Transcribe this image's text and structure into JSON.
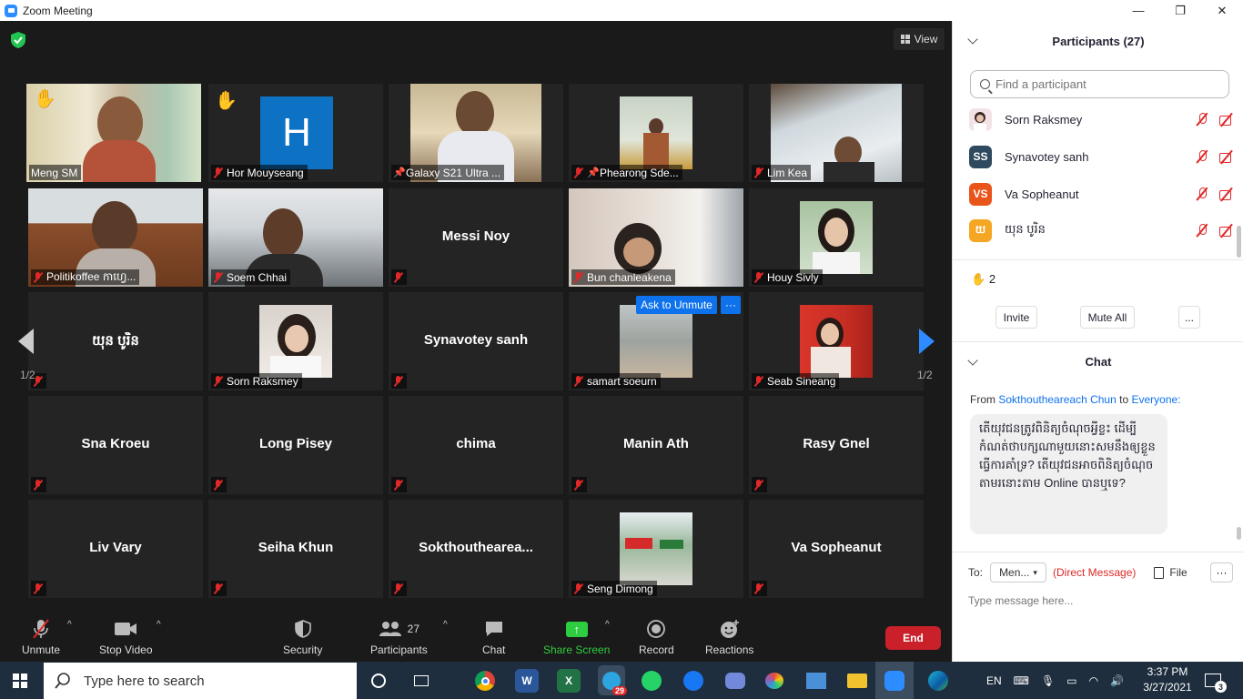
{
  "window": {
    "title": "Zoom Meeting",
    "minimize": "—",
    "restore": "❐",
    "close": "✕"
  },
  "view_button": {
    "label": "View"
  },
  "tiles": [
    {
      "name": "Meng SM",
      "muted": false,
      "hand": true,
      "active": true,
      "video": true
    },
    {
      "name": "Hor Mouyseang",
      "muted": true,
      "hand": true,
      "avatar_letter": "H"
    },
    {
      "name": "Galaxy S21 Ultra ...",
      "pinned": true,
      "video": true
    },
    {
      "name": "Phearong Sde...",
      "muted": true,
      "pinned": true,
      "video": true
    },
    {
      "name": "Lim Kea",
      "muted": true,
      "video": true
    },
    {
      "name": "Politikoffee កាហ្វេ...",
      "muted": true,
      "video": true
    },
    {
      "name": "Soem Chhai",
      "muted": true,
      "video": true
    },
    {
      "name": "Messi Noy",
      "muted": true
    },
    {
      "name": "Bun chanleakena",
      "muted": true,
      "video": true
    },
    {
      "name": "Houy Sivly",
      "muted": true,
      "video": true
    },
    {
      "name": "យុន បូរិន",
      "muted": true
    },
    {
      "name": "Sorn Raksmey",
      "muted": true,
      "video": true
    },
    {
      "name": "Synavotey sanh",
      "muted": true
    },
    {
      "name": "samart soeurn",
      "muted": true,
      "video": true
    },
    {
      "name": "Seab Sineang",
      "muted": true,
      "video": true
    },
    {
      "name": "Sna Kroeu",
      "muted": true
    },
    {
      "name": "Long Pisey",
      "muted": true
    },
    {
      "name": "chima",
      "muted": true
    },
    {
      "name": "Manin Ath",
      "muted": true
    },
    {
      "name": "Rasy Gnel",
      "muted": true
    },
    {
      "name": "Liv Vary",
      "muted": true
    },
    {
      "name": "Seiha Khun",
      "muted": true
    },
    {
      "name": "Sokthouthearea...",
      "muted": true
    },
    {
      "name": "Seng Dimong",
      "muted": true,
      "video": true
    },
    {
      "name": "Va Sopheanut",
      "muted": true
    }
  ],
  "pagination": {
    "left": "1/2",
    "right": "1/2"
  },
  "tile_actions": {
    "ask_to_unmute": "Ask to Unmute",
    "more": "···"
  },
  "toolbar": {
    "unmute": "Unmute",
    "stop_video": "Stop Video",
    "security": "Security",
    "participants": "Participants",
    "participants_count": "27",
    "chat": "Chat",
    "share_screen": "Share Screen",
    "record": "Record",
    "reactions": "Reactions",
    "end": "End"
  },
  "panel": {
    "participants_title": "Participants (27)",
    "search_placeholder": "Find a participant",
    "participants": [
      {
        "name": "Sorn Raksmey",
        "initials": "",
        "color": "#f3e3e6"
      },
      {
        "name": "Synavotey sanh",
        "initials": "SS",
        "color": "#2f4a5e"
      },
      {
        "name": "Va Sopheanut",
        "initials": "VS",
        "color": "#e8541a"
      },
      {
        "name": "យុន បូរិន",
        "initials": "យ",
        "color": "#f5a623"
      }
    ],
    "hand_count": "2",
    "invite": "Invite",
    "mute_all": "Mute All",
    "more": "...",
    "chat_title": "Chat",
    "chat_from_prefix": "From",
    "chat_sender": "Sokthouthearea​ch Chun",
    "chat_to_word": "to",
    "chat_recipient": "Everyone:",
    "chat_message": "តើយុវជនត្រូវពិនិត្យចំណុចអ្វីខ្លះ ដើម្បីកំណត់ថាបក្សណាមួយនោះសមនឹងឲ្យខ្លួនធ្វើការគាំទ្រ? តើយុវជនអាចពិនិត្យចំណុចតាមរនោះតាម Online បានឬទេ?",
    "to_label": "To:",
    "to_value": "Men...",
    "direct_message": "(Direct Message)",
    "file": "File",
    "chat_more": "···",
    "input_placeholder": "Type message here..."
  },
  "taskbar": {
    "search_placeholder": "Type here to search",
    "telegram_badge": "29",
    "lang": "EN",
    "time": "3:37 PM",
    "date": "3/27/2021",
    "notif_count": "3"
  }
}
